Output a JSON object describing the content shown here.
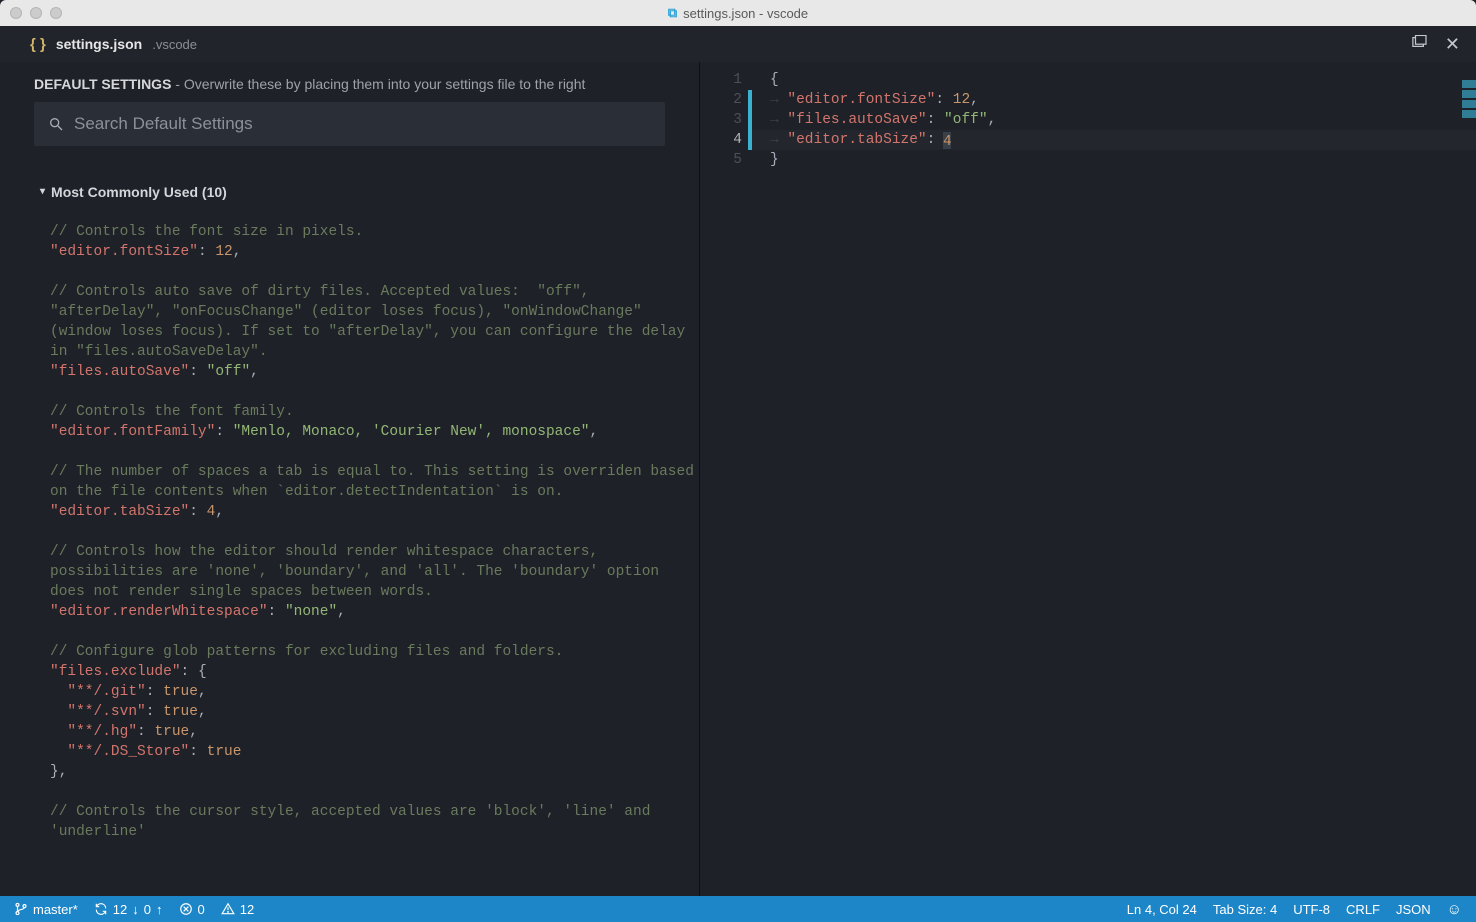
{
  "window": {
    "title": "settings.json - vscode"
  },
  "tab": {
    "filename": "settings.json",
    "dir": ".vscode"
  },
  "defaults_header": {
    "title": "DEFAULT SETTINGS",
    "subtitle": " - Overwrite these by placing them into your settings file to the right"
  },
  "search": {
    "placeholder": "Search Default Settings"
  },
  "section": {
    "title": "Most Commonly Used (10)"
  },
  "left_settings": [
    {
      "comment": "// Controls the font size in pixels.",
      "key": "\"editor.fontSize\"",
      "sep": ": ",
      "val_num": "12",
      "trail": ","
    },
    {
      "comment": "// Controls auto save of dirty files. Accepted values:  \"off\", \"afterDelay\", \"onFocusChange\" (editor loses focus), \"onWindowChange\" (window loses focus). If set to \"afterDelay\", you can configure the delay in \"files.autoSaveDelay\".",
      "key": "\"files.autoSave\"",
      "sep": ": ",
      "val_str": "\"off\"",
      "trail": ","
    },
    {
      "comment": "// Controls the font family.",
      "key": "\"editor.fontFamily\"",
      "sep": ": ",
      "val_str": "\"Menlo, Monaco, 'Courier New', monospace\"",
      "trail": ","
    },
    {
      "comment": "// The number of spaces a tab is equal to. This setting is overriden based on the file contents when `editor.detectIndentation` is on.",
      "key": "\"editor.tabSize\"",
      "sep": ": ",
      "val_num": "4",
      "trail": ","
    },
    {
      "comment": "// Controls how the editor should render whitespace characters, possibilities are 'none', 'boundary', and 'all'. The 'boundary' option does not render single spaces between words.",
      "key": "\"editor.renderWhitespace\"",
      "sep": ": ",
      "val_str": "\"none\"",
      "trail": ","
    },
    {
      "comment": "// Configure glob patterns for excluding files and folders.",
      "key": "\"files.exclude\"",
      "sep": ": ",
      "brace": "{",
      "entries": [
        {
          "k": "\"**/.git\"",
          "v": "true",
          "t": ","
        },
        {
          "k": "\"**/.svn\"",
          "v": "true",
          "t": ","
        },
        {
          "k": "\"**/.hg\"",
          "v": "true",
          "t": ","
        },
        {
          "k": "\"**/.DS_Store\"",
          "v": "true",
          "t": ""
        }
      ],
      "close": "},"
    },
    {
      "comment": "// Controls the cursor style, accepted values are 'block', 'line' and 'underline'"
    }
  ],
  "right_editor": {
    "lines": [
      {
        "n": "1",
        "raw": "{"
      },
      {
        "n": "2",
        "key": "\"editor.fontSize\"",
        "val_num": "12",
        "trail": ",",
        "changed": true
      },
      {
        "n": "3",
        "key": "\"files.autoSave\"",
        "val_str": "\"off\"",
        "trail": ",",
        "changed": true
      },
      {
        "n": "4",
        "key": "\"editor.tabSize\"",
        "val_num_cursor": "4",
        "trail": "",
        "changed": true,
        "active": true
      },
      {
        "n": "5",
        "raw": "}"
      }
    ]
  },
  "status": {
    "branch": "master*",
    "sync_down": "12",
    "sync_up": "0",
    "errors": "0",
    "warnings": "12",
    "cursor": "Ln 4, Col 24",
    "tabsize": "Tab Size: 4",
    "encoding": "UTF-8",
    "eol": "CRLF",
    "lang": "JSON"
  }
}
